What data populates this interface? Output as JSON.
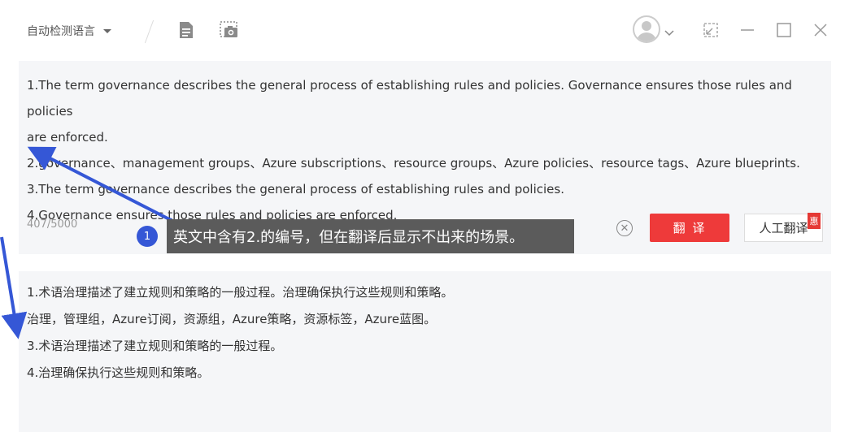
{
  "toolbar": {
    "source_language": "自动检测语言"
  },
  "source": {
    "lines": [
      "1.The term governance describes the general process of establishing rules and policies. Governance ensures those rules and policies",
      "are enforced.",
      "2.governance、management groups、Azure subscriptions、resource groups、Azure policies、resource tags、Azure blueprints.",
      "3.The term governance describes the general process of establishing rules and policies.",
      "4.Governance ensures those rules and policies are enforced."
    ],
    "char_count": "407/5000"
  },
  "actions": {
    "translate_label": "翻 译",
    "human_translate_label": "人工翻译",
    "promo_badge": "惠"
  },
  "result": {
    "lines": [
      "1.术语治理描述了建立规则和策略的一般过程。治理确保执行这些规则和策略。",
      "治理，管理组，Azure订阅，资源组，Azure策略，资源标签，Azure蓝图。",
      "3.术语治理描述了建立规则和策略的一般过程。",
      "4.治理确保执行这些规则和策略。"
    ]
  },
  "annotation": {
    "step_number": "1",
    "note": "英文中含有2.的编号，但在翻译后显示不出来的场景。"
  },
  "colors": {
    "accent_red": "#ee3a3a",
    "annotation_blue": "#3557d6",
    "panel_bg": "#f5f6f8"
  }
}
